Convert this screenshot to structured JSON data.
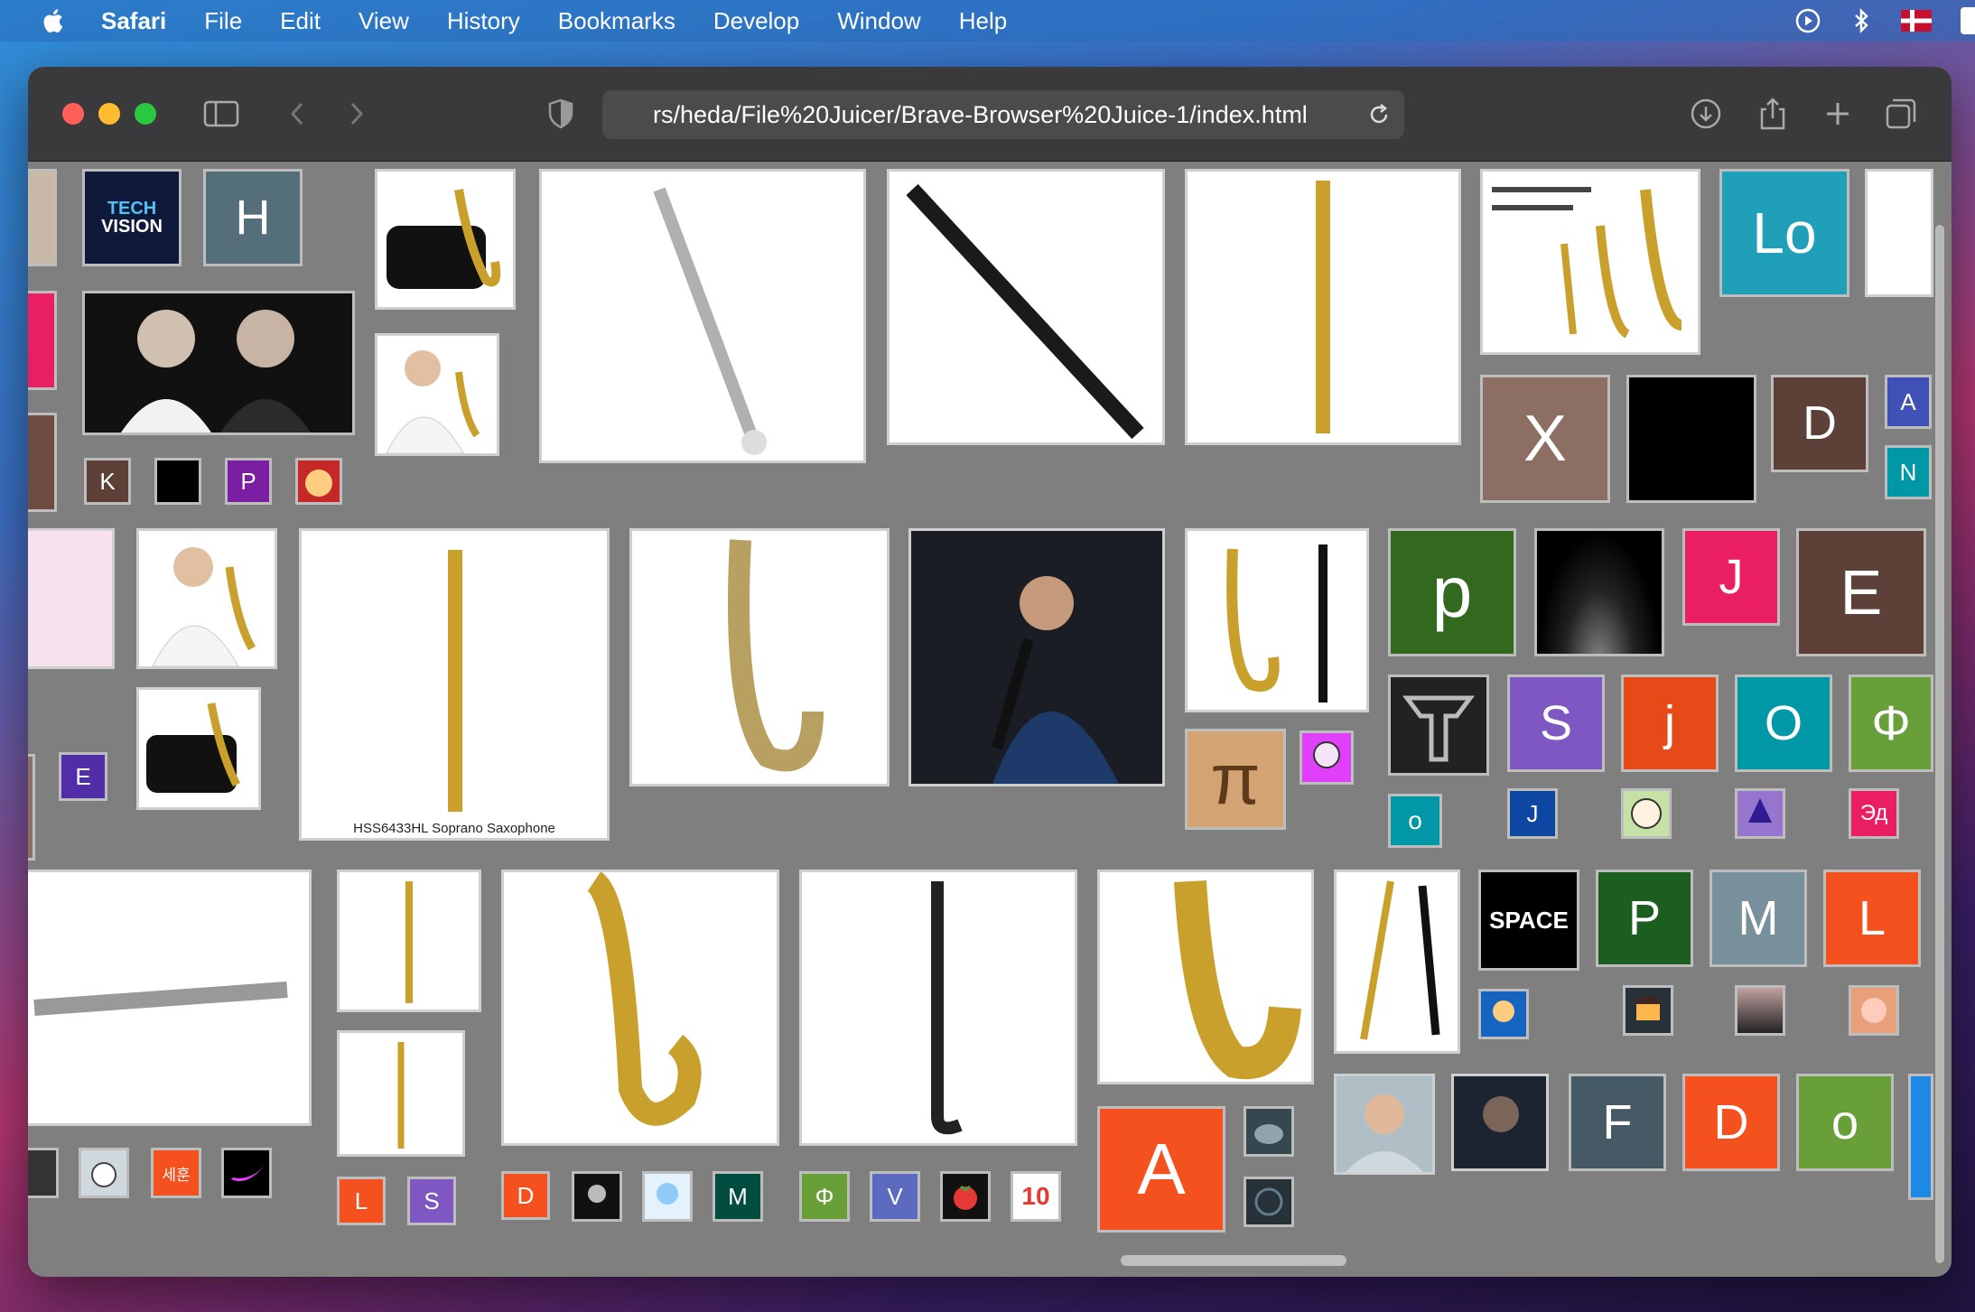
{
  "menubar": {
    "app_name": "Safari",
    "items": [
      "File",
      "Edit",
      "View",
      "History",
      "Bookmarks",
      "Develop",
      "Window",
      "Help"
    ]
  },
  "toolbar": {
    "url": "rs/heda/File%20Juicer/Brave-Browser%20Juice-1/index.html"
  },
  "letters": {
    "H": "H",
    "K": "K",
    "P1": "P",
    "E1": "E",
    "Lo": "Lo",
    "X": "X",
    "D1": "D",
    "A1": "A",
    "N": "N",
    "p": "p",
    "J1": "J",
    "E2": "E",
    "pi": "π",
    "S1": "S",
    "j": "j",
    "O1": "O",
    "Phi1": "Φ",
    "o1": "o",
    "J2": "J",
    "Ed": "Эд",
    "P2": "P",
    "M1": "M",
    "L1": "L",
    "F": "F",
    "D2": "D",
    "o2": "o",
    "A2": "A",
    "L2": "L",
    "S2": "S",
    "D3": "D",
    "M2": "M",
    "Phi2": "Φ",
    "V": "V",
    "ten": "10",
    "korean": "세훈"
  },
  "logos": {
    "tech_vision_top": "TECH",
    "tech_vision_bottom": "VISION",
    "space": "SPACE",
    "soprano_caption": "HSS6433HL Soprano Saxophone"
  },
  "colors": {
    "tile_lo": "#1fa0b8",
    "tile_x": "#8d6e63",
    "tile_d": "#5d4037",
    "tile_blue": "#3f51b5",
    "tile_teal": "#0097a7",
    "tile_green": "#33691e",
    "tile_pink": "#e91e63",
    "tile_purple": "#7e57c2",
    "tile_orange": "#e64a19",
    "tile_lightgreen": "#689f38",
    "tile_slate": "#455a64",
    "tile_bluegrey": "#78909c",
    "tile_darkgreen": "#1b5e20"
  }
}
